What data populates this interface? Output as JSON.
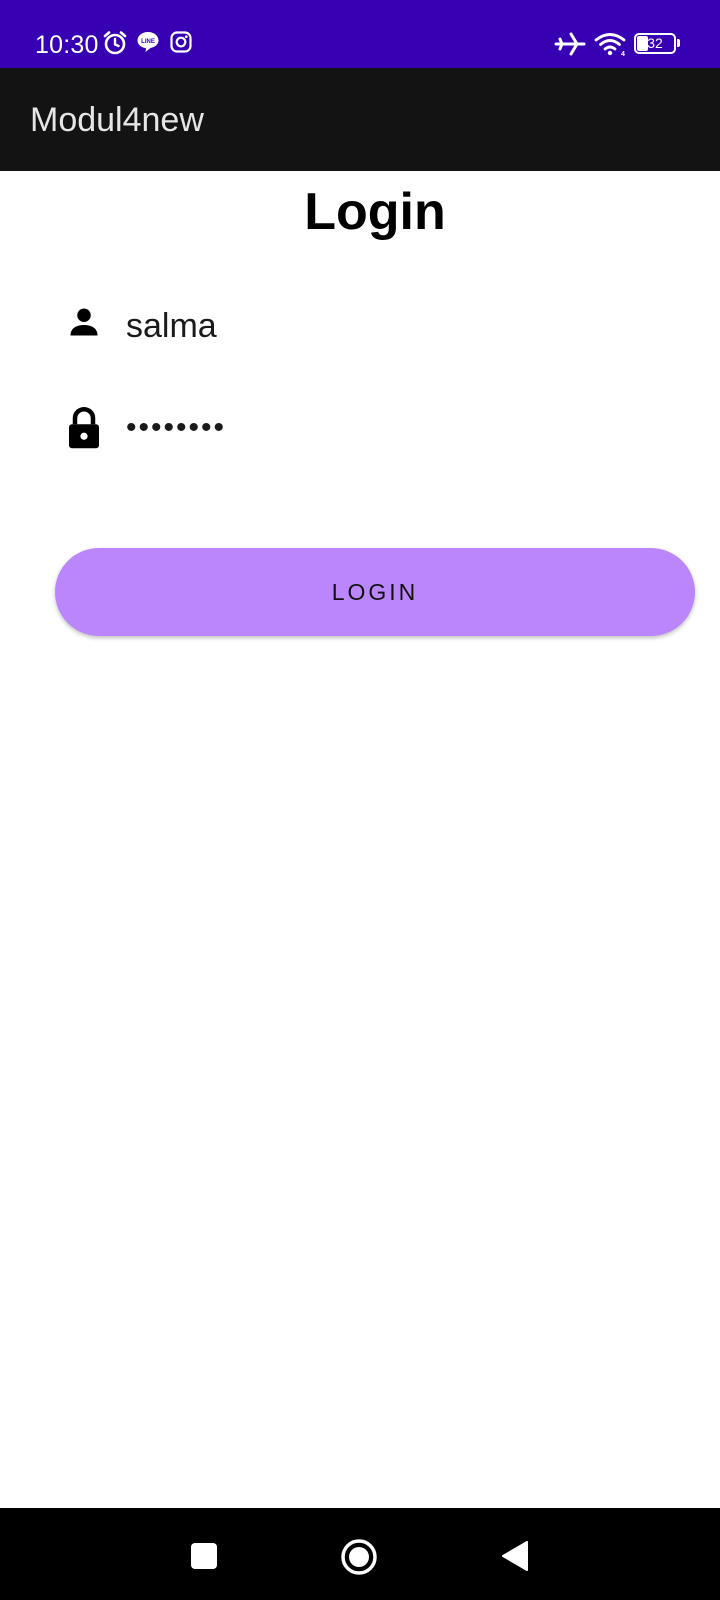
{
  "status_bar": {
    "time": "10:30",
    "battery_level": "32",
    "left_icons": [
      "alarm-icon",
      "line-app-icon",
      "instagram-icon"
    ],
    "right_icons": [
      "airplane-mode-icon",
      "wifi-icon",
      "battery-icon"
    ],
    "background": "#3700b3"
  },
  "app_bar": {
    "title": "Modul4new",
    "background": "#131313"
  },
  "login": {
    "heading": "Login",
    "username_value": "salma",
    "password_value": "••••••••",
    "button_label": "LOGIN",
    "button_color": "#bb86fc",
    "username_icon": "person-icon",
    "password_icon": "lock-icon"
  },
  "nav_bar": {
    "buttons": [
      "recents-square-icon",
      "home-circle-icon",
      "back-triangle-icon"
    ]
  }
}
